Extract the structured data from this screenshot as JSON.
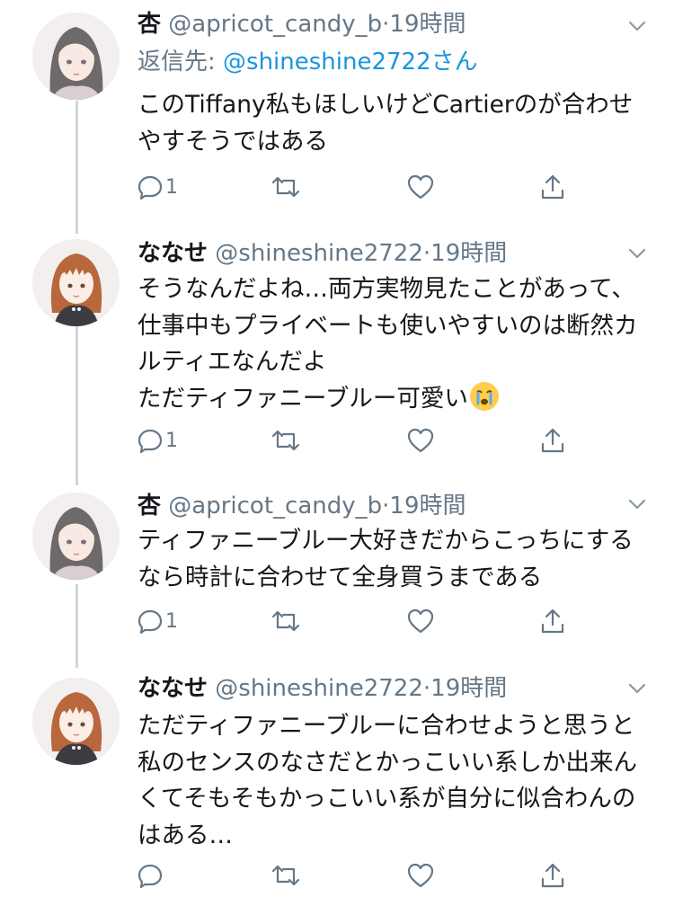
{
  "colors": {
    "text": "#14171a",
    "secondary": "#657786",
    "link": "#1b95e0",
    "thread_line": "#ccd6dd"
  },
  "tweets": [
    {
      "name": "杏",
      "handle": "@apricot_candy_b",
      "time": "·19時間",
      "reply_prefix": "返信先: ",
      "reply_handle": "@shineshine2722さん",
      "text": "このTiffany私もほしいけどCartierのが合わせやすそうではある",
      "reply_count": "1",
      "avatar": "gray-hair-girl-avatar"
    },
    {
      "name": "ななせ",
      "handle": "@shineshine2722",
      "time": "·19時間",
      "text": "そうなんだよね…両方実物見たことがあって、仕事中もプライベートも使いやすいのは断然カルティエなんだよ\nただティファニーブルー可愛い",
      "emoji": "crying-face-emoji",
      "reply_count": "1",
      "avatar": "brown-hair-girl-avatar"
    },
    {
      "name": "杏",
      "handle": "@apricot_candy_b",
      "time": "·19時間",
      "text": "ティファニーブルー大好きだからこっちにするなら時計に合わせて全身買うまである",
      "reply_count": "1",
      "avatar": "gray-hair-girl-avatar"
    },
    {
      "name": "ななせ",
      "handle": "@shineshine2722",
      "time": "·19時間",
      "text": "ただティファニーブルーに合わせようと思うと私のセンスのなさだとかっこいい系しか出来んくてそもそもかっこいい系が自分に似合わんのはある…",
      "reply_count": "",
      "avatar": "brown-hair-girl-avatar"
    }
  ]
}
